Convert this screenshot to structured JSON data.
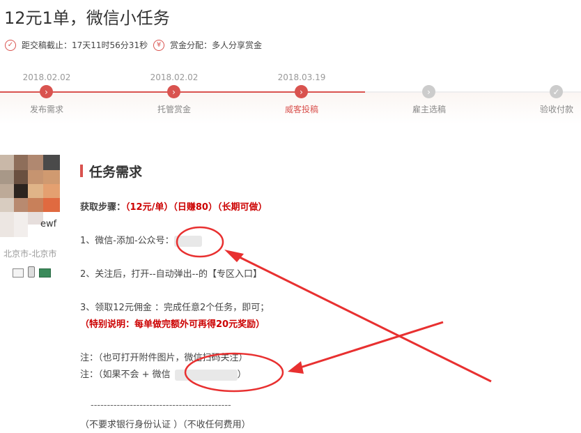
{
  "title": "12元1单，微信小任务",
  "meta": {
    "deadline": "距交稿截止：17天11时56分31秒",
    "reward": "赏金分配：多人分享赏金",
    "deadline_icon": "clock-check-icon",
    "reward_icon": "yen-icon"
  },
  "steps": [
    {
      "date": "2018.02.02",
      "label": "发布需求",
      "state": "done"
    },
    {
      "date": "2018.02.02",
      "label": "托管赏金",
      "state": "done"
    },
    {
      "date": "2018.03.19",
      "label": "威客投稿",
      "state": "current"
    },
    {
      "date": "",
      "label": "雇主选稿",
      "state": "pending"
    },
    {
      "date": "",
      "label": "验收付款",
      "state": "pending"
    }
  ],
  "user": {
    "name_suffix": "ewf",
    "location": "北京市-北京市"
  },
  "task": {
    "heading": "任务需求",
    "steps_label": "获取步骤：",
    "steps_highlight": "（12元/单）（日赚80）（长期可做）",
    "line1": "1、微信-添加-公众号：",
    "line2": "2、关注后，打开--自动弹出--的【专区入口】",
    "line3": "3、领取12元佣金 ：完成任意2个任务，即可；",
    "special": "（特别说明：每单做完额外可再得20元奖励）",
    "note1": "注：（也可打开附件图片，微信扫码关注）",
    "note2_prefix": "注：（如果不会 + 微信",
    "note2_suffix": "）",
    "dashes": "-------------------------------------------",
    "footer": "（不要求银行身份认证 ）（不收任何费用）"
  },
  "colors": {
    "accent": "#d9534f",
    "pending": "#cccccc",
    "annotation": "#e83030"
  }
}
